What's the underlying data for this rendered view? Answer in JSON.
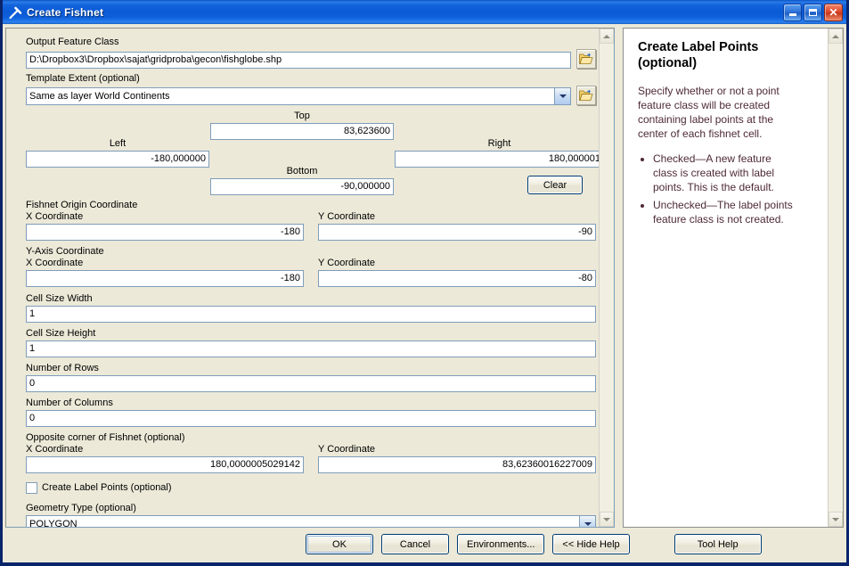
{
  "window": {
    "title": "Create Fishnet",
    "icon": "hammer-tool-icon",
    "minimize_label": "Minimize",
    "maximize_label": "Maximize",
    "close_label": "Close"
  },
  "params": {
    "output_feature_class": {
      "label": "Output Feature Class",
      "value": "D:\\Dropbox3\\Dropbox\\sajat\\gridproba\\gecon\\fishglobe.shp",
      "browse_icon": "open-folder-icon"
    },
    "template_extent": {
      "label": "Template Extent (optional)",
      "value": "Same as layer World Continents",
      "browse_icon": "open-folder-icon"
    },
    "extent": {
      "top_label": "Top",
      "top_value": "83,623600",
      "left_label": "Left",
      "left_value": "-180,000000",
      "right_label": "Right",
      "right_value": "180,000001",
      "bottom_label": "Bottom",
      "bottom_value": "-90,000000",
      "clear_label": "Clear"
    },
    "origin": {
      "section_label": "Fishnet Origin Coordinate",
      "x_label": "X Coordinate",
      "x_value": "-180",
      "y_label": "Y Coordinate",
      "y_value": "-90"
    },
    "yaxis": {
      "section_label": "Y-Axis Coordinate",
      "x_label": "X Coordinate",
      "x_value": "-180",
      "y_label": "Y Coordinate",
      "y_value": "-80"
    },
    "cell_size_width": {
      "label": "Cell Size Width",
      "value": "1"
    },
    "cell_size_height": {
      "label": "Cell Size Height",
      "value": "1"
    },
    "number_of_rows": {
      "label": "Number of Rows",
      "value": "0"
    },
    "number_of_columns": {
      "label": "Number of Columns",
      "value": "0"
    },
    "opposite_corner": {
      "section_label": "Opposite corner of Fishnet (optional)",
      "x_label": "X Coordinate",
      "x_value": "180,0000005029142",
      "y_label": "Y Coordinate",
      "y_value": "83,62360016227009"
    },
    "create_label_points": {
      "label": "Create Label Points (optional)",
      "checked": false
    },
    "geometry_type": {
      "label": "Geometry Type (optional)",
      "value": "POLYGON"
    }
  },
  "help": {
    "title": "Create Label Points (optional)",
    "paragraph": "Specify whether or not a point feature class will be created containing label points at the center of each fishnet cell.",
    "bullets": [
      "Checked—A new feature class is created with label points. This is the default.",
      "Unchecked—The label points feature class is not created."
    ]
  },
  "footer": {
    "ok": "OK",
    "cancel": "Cancel",
    "environments": "Environments...",
    "hide_help": "<< Hide Help",
    "tool_help": "Tool Help"
  }
}
